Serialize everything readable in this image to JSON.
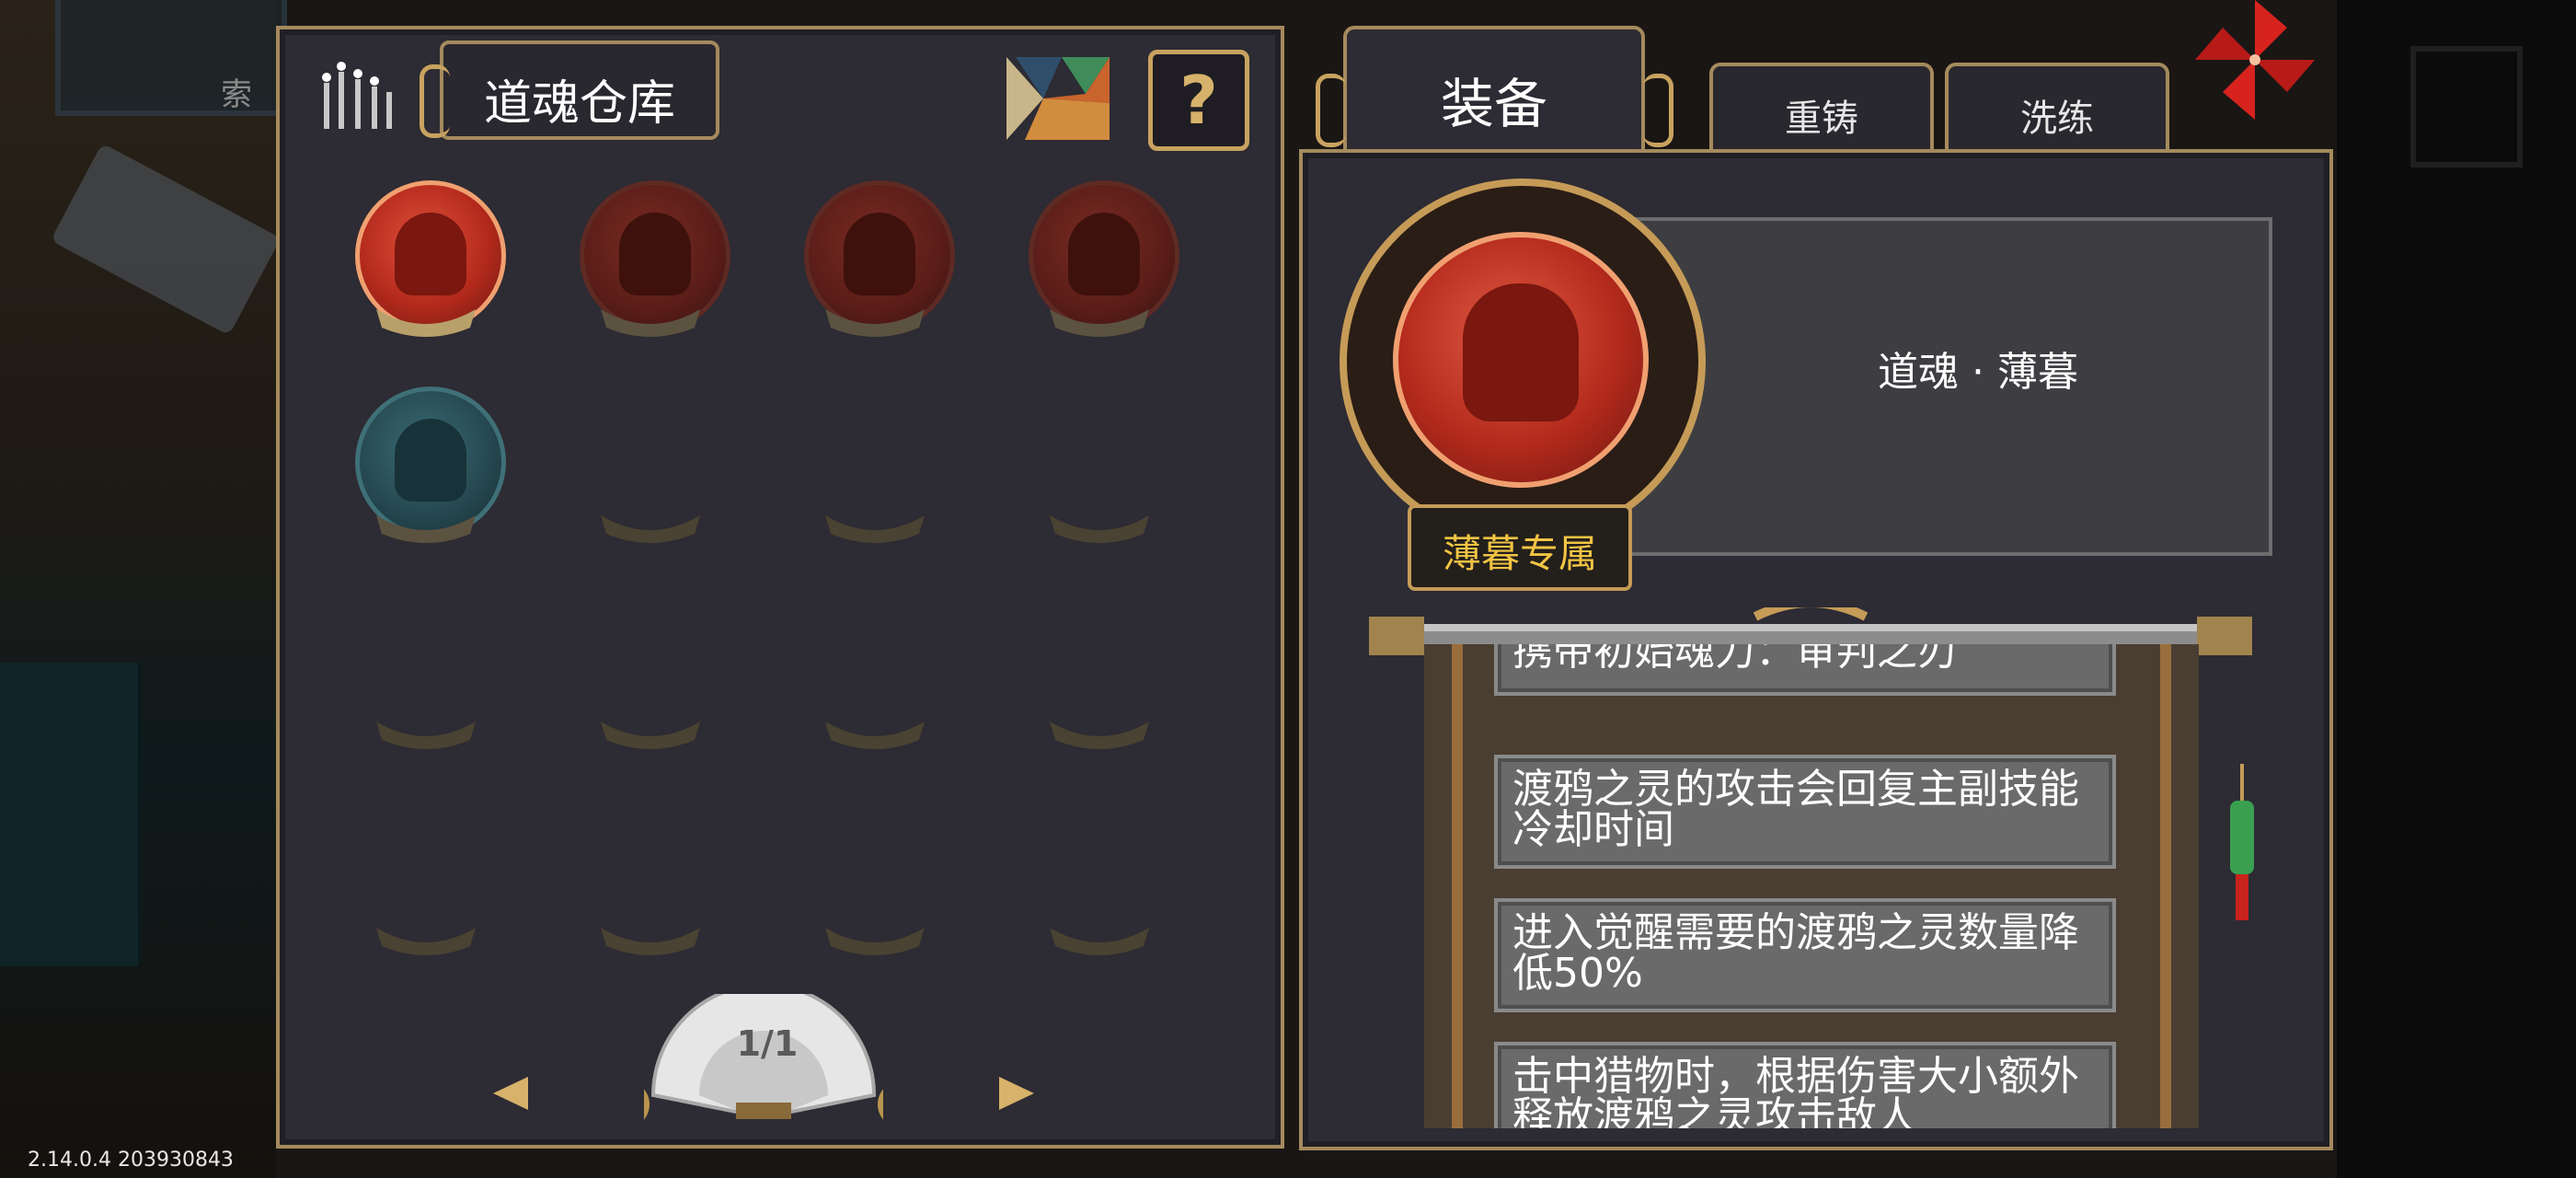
{
  "warehouse": {
    "title": "道魂仓库",
    "help_label": "?",
    "page_indicator": "1/1"
  },
  "tabs": {
    "equip": "装备",
    "recast": "重铸",
    "refine": "洗练"
  },
  "detail": {
    "soul_name": "道魂 · 薄暮",
    "exclusive_tag": "薄暮专属",
    "effects": [
      "携带初始魂力：审判之刃",
      "渡鸦之灵的攻击会回复主副技能冷却时间",
      "进入觉醒需要的渡鸦之灵数量降低50%",
      "击中猎物时，根据伤害大小额外释放渡鸦之灵攻击敌人"
    ]
  },
  "background": {
    "sign_text": "索"
  },
  "version": "2.14.0.4 203930843",
  "colors": {
    "panel": "#2d2b33",
    "gold_border": "#a58a5c",
    "orb_red": "#b42a1c",
    "orb_teal": "#25474f",
    "exclusive_text": "#f2c444"
  }
}
